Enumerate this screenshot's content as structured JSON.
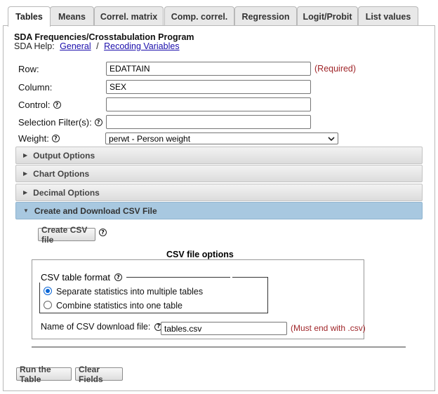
{
  "tabs": [
    {
      "label": "Tables",
      "active": true
    },
    {
      "label": "Means"
    },
    {
      "label": "Correl. matrix"
    },
    {
      "label": "Comp. correl."
    },
    {
      "label": "Regression"
    },
    {
      "label": "Logit/Probit"
    },
    {
      "label": "List values"
    }
  ],
  "header": {
    "title": "SDA Frequencies/Crosstabulation Program",
    "help_prefix": "SDA Help:",
    "help_links": [
      "General",
      "Recoding Variables"
    ],
    "help_sep": "/"
  },
  "form": {
    "row": {
      "label": "Row:",
      "value": "EDATTAIN",
      "required": "(Required)"
    },
    "column": {
      "label": "Column:",
      "value": "SEX"
    },
    "control": {
      "label": "Control:",
      "value": ""
    },
    "filter": {
      "label": "Selection Filter(s):",
      "value": ""
    },
    "weight": {
      "label": "Weight:",
      "value": "perwt - Person weight"
    }
  },
  "sections": [
    {
      "label": "Output Options",
      "open": false
    },
    {
      "label": "Chart Options",
      "open": false
    },
    {
      "label": "Decimal Options",
      "open": false
    },
    {
      "label": "Create and Download CSV File",
      "open": true
    }
  ],
  "csv": {
    "create_button": "Create CSV file",
    "options_title": "CSV file options",
    "format_legend": "CSV table format",
    "radio_options": [
      {
        "label": "Separate statistics into multiple tables",
        "checked": true
      },
      {
        "label": "Combine statistics into one table",
        "checked": false
      }
    ],
    "filename_label": "Name of CSV download file:",
    "filename_value": "tables.csv",
    "filename_note": "(Must end with .csv)"
  },
  "footer": {
    "run_button": "Run the Table",
    "clear_button": "Clear Fields"
  },
  "colors": {
    "required": "#a0262a",
    "link": "#1a0dab",
    "open_section": "#a8c8e0",
    "radio_checked": "#0a66d6"
  }
}
